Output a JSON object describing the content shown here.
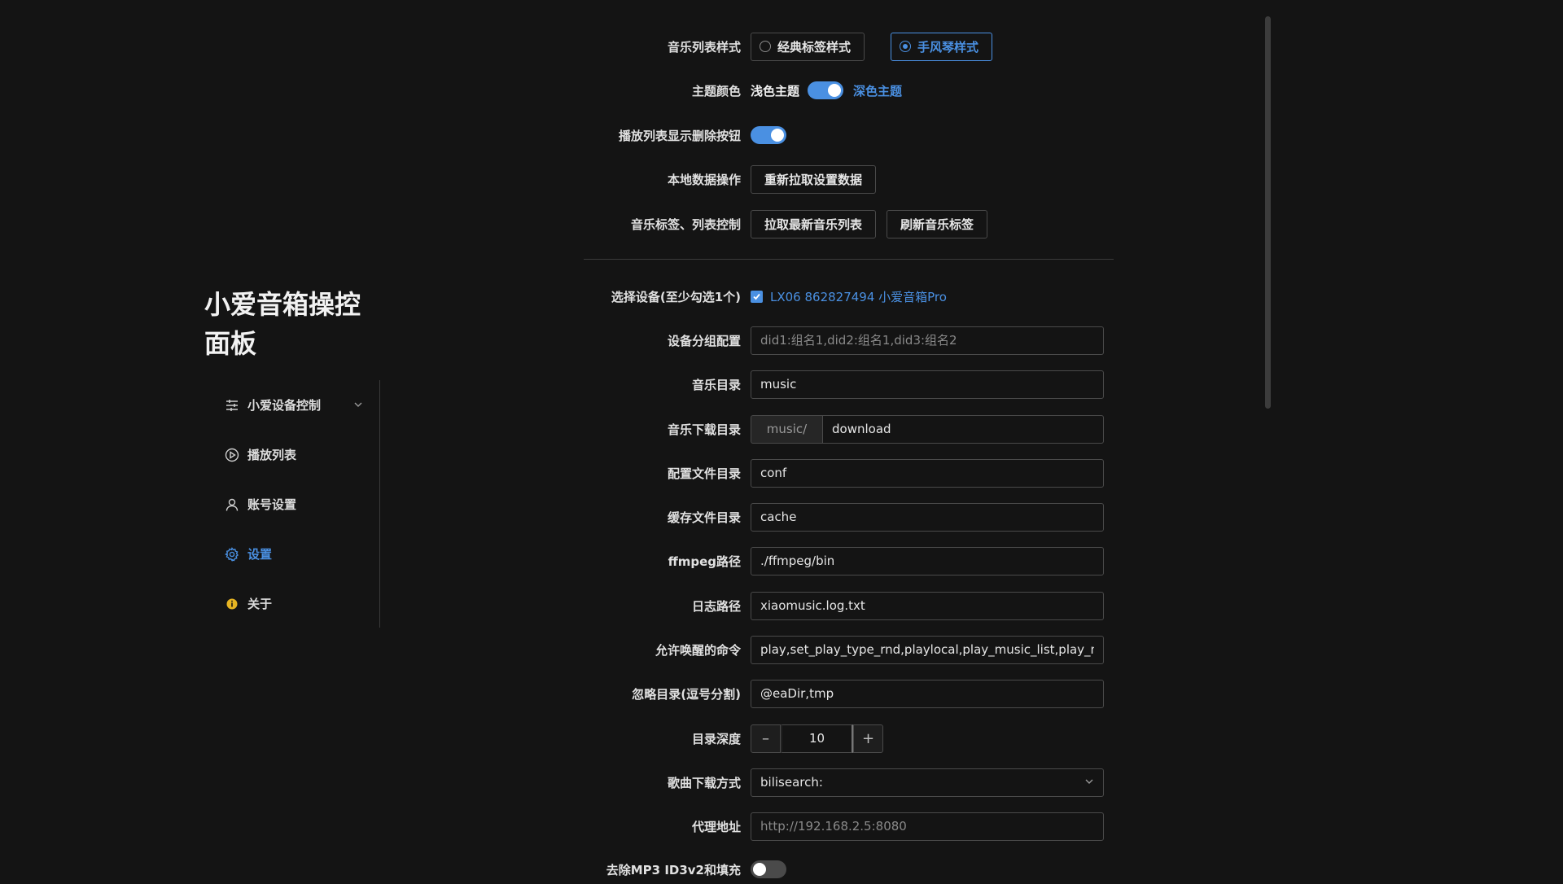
{
  "sidebar": {
    "title": "小爱音箱操控面板",
    "items": [
      {
        "label": "小爱设备控制"
      },
      {
        "label": "播放列表"
      },
      {
        "label": "账号设置"
      },
      {
        "label": "设置"
      },
      {
        "label": "关于"
      }
    ]
  },
  "settings": {
    "music_list_style": {
      "label": "音乐列表样式",
      "options": [
        "经典标签样式",
        "手风琴样式"
      ],
      "selected": "手风琴样式"
    },
    "theme": {
      "label": "主题颜色",
      "light": "浅色主题",
      "dark": "深色主题"
    },
    "show_delete": {
      "label": "播放列表显示删除按钮"
    },
    "local_data": {
      "label": "本地数据操作",
      "button": "重新拉取设置数据"
    },
    "music_tags": {
      "label": "音乐标签、列表控制",
      "button1": "拉取最新音乐列表",
      "button2": "刷新音乐标签"
    },
    "select_device": {
      "label": "选择设备(至少勾选1个)",
      "device": "LX06 862827494 小爱音箱Pro"
    },
    "device_group": {
      "label": "设备分组配置",
      "placeholder": "did1:组名1,did2:组名1,did3:组名2"
    },
    "music_dir": {
      "label": "音乐目录",
      "value": "music"
    },
    "download_dir": {
      "label": "音乐下载目录",
      "prefix": "music/",
      "value": "download"
    },
    "conf_dir": {
      "label": "配置文件目录",
      "value": "conf"
    },
    "cache_dir": {
      "label": "缓存文件目录",
      "value": "cache"
    },
    "ffmpeg": {
      "label": "ffmpeg路径",
      "value": "./ffmpeg/bin"
    },
    "log": {
      "label": "日志路径",
      "value": "xiaomusic.log.txt"
    },
    "wake_cmds": {
      "label": "允许唤醒的命令",
      "value": "play,set_play_type_rnd,playlocal,play_music_list,play_music_"
    },
    "ignore_dirs": {
      "label": "忽略目录(逗号分割)",
      "value": "@eaDir,tmp"
    },
    "depth": {
      "label": "目录深度",
      "value": "10"
    },
    "download_method": {
      "label": "歌曲下载方式",
      "value": "bilisearch:"
    },
    "proxy": {
      "label": "代理地址",
      "placeholder": "http://192.168.2.5:8080"
    },
    "remove_id3": {
      "label": "去除MP3 ID3v2和填充"
    }
  },
  "colors": {
    "accent": "#4a90e2",
    "background": "#141414"
  }
}
